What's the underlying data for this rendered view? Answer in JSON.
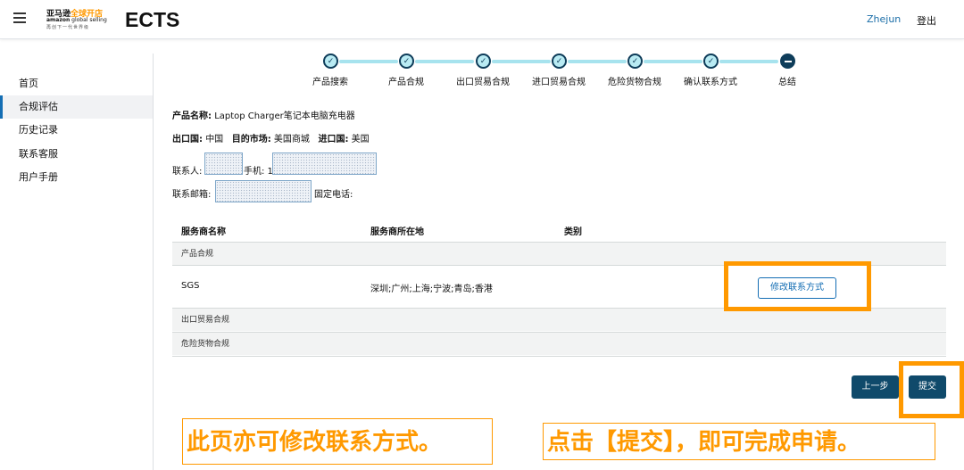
{
  "header": {
    "logo_cn_black": "亚马逊",
    "logo_cn_orange": "全球开店",
    "logo_en_bold": "amazon",
    "logo_en_rest": " global selling",
    "logo_tagline": "再创下一代世界级",
    "app_title": "ECTS",
    "user_name": "Zhejun",
    "logout": "登出",
    "menu_icon": "hamburger-menu-icon"
  },
  "sidebar": {
    "items": [
      {
        "label": "首页",
        "active": false
      },
      {
        "label": "合规评估",
        "active": true
      },
      {
        "label": "历史记录",
        "active": false
      },
      {
        "label": "联系客服",
        "active": false
      },
      {
        "label": "用户手册",
        "active": false
      }
    ]
  },
  "stepper": {
    "steps": [
      {
        "label": "产品搜索",
        "status": "done",
        "icon": "check-icon"
      },
      {
        "label": "产品合规",
        "status": "done",
        "icon": "check-icon"
      },
      {
        "label": "出口贸易合规",
        "status": "done",
        "icon": "check-icon"
      },
      {
        "label": "进口贸易合规",
        "status": "done",
        "icon": "check-icon"
      },
      {
        "label": "危险货物合规",
        "status": "done",
        "icon": "check-icon"
      },
      {
        "label": "确认联系方式",
        "status": "done",
        "icon": "check-icon"
      },
      {
        "label": "总结",
        "status": "current",
        "icon": "minus-icon"
      }
    ]
  },
  "summary": {
    "product_name_label": "产品名称:",
    "product_name_value": "Laptop Charger笔记本电脑充电器",
    "export_country_label": "出口国:",
    "export_country_value": "中国",
    "target_market_label": "目的市场:",
    "target_market_value": "美国商城",
    "import_country_label": "进口国:",
    "import_country_value": "美国",
    "contact_label": "联系人:",
    "mobile_label": "手机: 1",
    "email_label": "联系邮箱:",
    "phone_label": "固定电话:"
  },
  "table": {
    "headers": [
      "服务商名称",
      "服务商所在地",
      "类别"
    ],
    "groups": [
      {
        "name": "产品合规",
        "rows": [
          {
            "provider": "SGS",
            "location": "深圳;广州;上海;宁波;青岛;香港",
            "category": "",
            "action": "修改联系方式"
          }
        ]
      },
      {
        "name": "出口贸易合规",
        "rows": []
      },
      {
        "name": "危险货物合规",
        "rows": []
      }
    ]
  },
  "actions": {
    "prev": "上一步",
    "submit": "提交"
  },
  "annotations": {
    "note_left": "此页亦可修改联系方式。",
    "note_right": "点击【提交】，即可完成申请。",
    "highlight_color": "#ff9900"
  },
  "colors": {
    "primary_dark": "#0f4a6b",
    "link_blue": "#146eb4",
    "step_fill": "#b9ebf3"
  }
}
